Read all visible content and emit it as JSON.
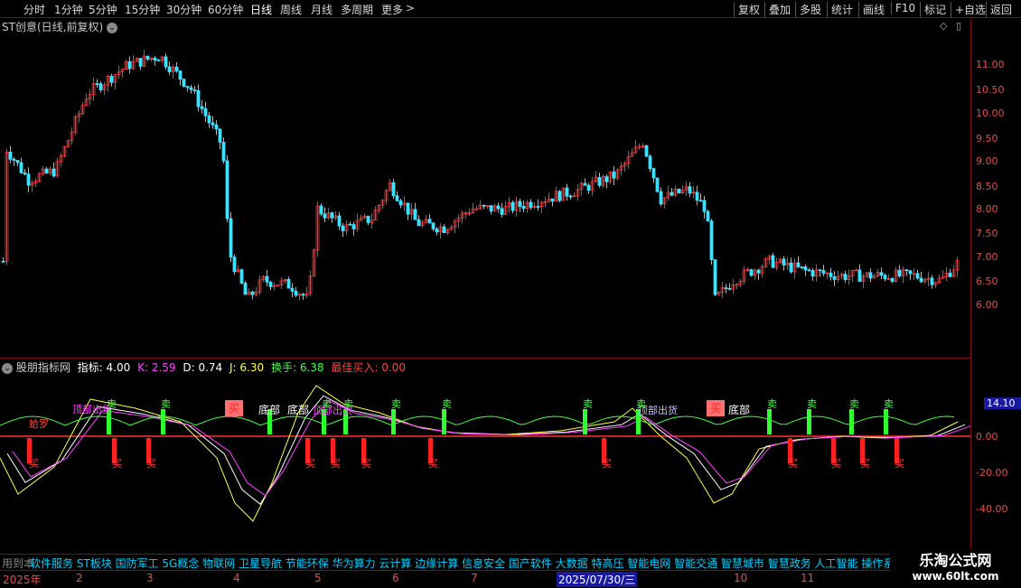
{
  "toolbar": {
    "periods": [
      "分时",
      "1分钟",
      "5分钟",
      "15分钟",
      "30分钟",
      "60分钟",
      "日线",
      "周线",
      "月线",
      "多周期",
      "更多"
    ],
    "more_arrow": ">",
    "right_buttons": [
      "复权",
      "叠加",
      "多股",
      "统计",
      "画线",
      "F10",
      "标记",
      "+自选",
      "返回"
    ]
  },
  "chart_title": "ST创意(日线,前复权)",
  "price_axis": [
    "11.00",
    "10.50",
    "10.00",
    "9.50",
    "9.00",
    "8.50",
    "8.00",
    "7.50",
    "7.00",
    "6.50",
    "6.00"
  ],
  "indicator": {
    "name": "股朋指标网",
    "zhibiao_label": "指标: 4.00",
    "k_label": "K: 2.59",
    "d_label": "D: 0.74",
    "j_label": "J: 6.30",
    "huanshou_label": "换手: 6.38",
    "buy_label": "最佳买入: 0.00"
  },
  "indicator_axis": [
    "20.00",
    "0.00",
    "-20.00",
    "-40.00"
  ],
  "indicator_current": "14.10",
  "signals": {
    "sell": "卖",
    "buy": "买",
    "bottom": "底部",
    "top_out": "顶部出货",
    "top_alt": "顶部出货",
    "bottom_x": "蛤罗"
  },
  "status_prefix": "用到本",
  "status_sectors": "软件服务 ST板块 国防军工 5G概念 物联网 卫星导航 节能环保 华为算力 云计算 边缘计算 信息安全 国产软件 大数据 特高压 智能电网 智能交通 智慧城市 智慧政务 人工智能 操作系统",
  "date_axis": {
    "year": "2025年",
    "months": [
      "2",
      "3",
      "4",
      "5",
      "6",
      "7",
      "10",
      "11"
    ],
    "highlight": "2025/07/30/三"
  },
  "watermark": {
    "title": "乐淘公式网",
    "url": "www.60lt.com"
  }
}
